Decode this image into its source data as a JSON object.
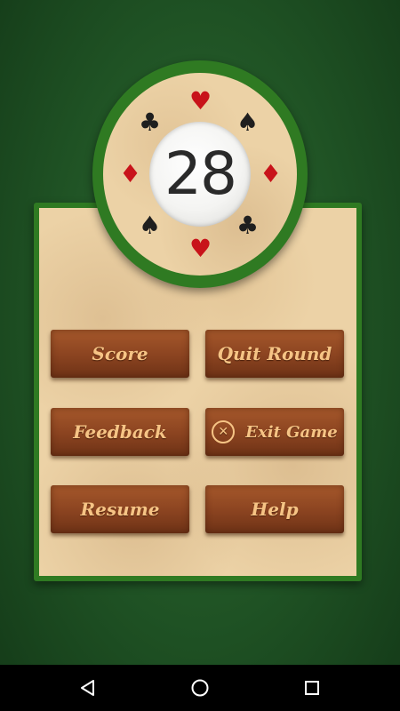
{
  "chip": {
    "number": "28",
    "suits": [
      {
        "name": "heart-top-icon",
        "glyph": "♥",
        "color": "red"
      },
      {
        "name": "spade-left-icon",
        "glyph": "♣",
        "color": "black"
      },
      {
        "name": "spade-right-icon",
        "glyph": "♠",
        "color": "black"
      },
      {
        "name": "diamond-left-icon",
        "glyph": "♦",
        "color": "red"
      },
      {
        "name": "diamond-right-icon",
        "glyph": "♦",
        "color": "red"
      },
      {
        "name": "spade-lower-left-icon",
        "glyph": "♠",
        "color": "black"
      },
      {
        "name": "club-lower-right-icon",
        "glyph": "♣",
        "color": "black"
      },
      {
        "name": "heart-bottom-icon",
        "glyph": "♥",
        "color": "red"
      }
    ]
  },
  "menu": {
    "score": "Score",
    "quit_round": "Quit Round",
    "feedback": "Feedback",
    "exit_game": "Exit Game",
    "exit_icon": "✕",
    "resume": "Resume",
    "help": "Help"
  },
  "colors": {
    "felt_green": "#1f5224",
    "panel_border": "#2f7a22",
    "parchment": "#ecd2a6",
    "button_wood": "#8a4320",
    "button_text": "#f6c485",
    "suit_red": "#c8131a",
    "suit_black": "#1f1f1f"
  },
  "navbar": {
    "icons": [
      "back-icon",
      "home-icon",
      "recents-icon"
    ]
  }
}
